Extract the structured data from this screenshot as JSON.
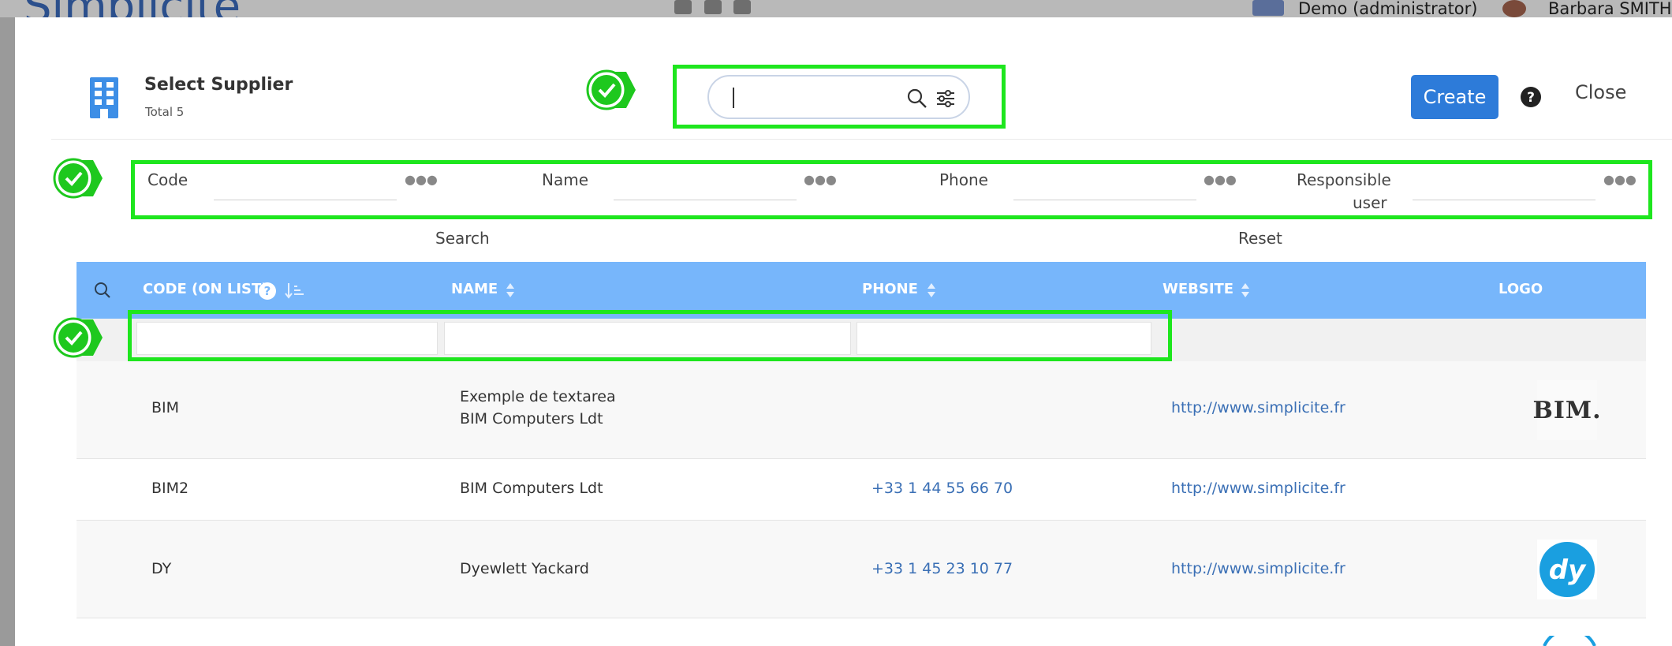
{
  "background": {
    "app_name": "Simplicite",
    "user_scope": "Demo (administrator)",
    "user_name": "Barbara SMITH"
  },
  "header": {
    "title": "Select Supplier",
    "subtitle": "Total 5",
    "search_value": "",
    "create_label": "Create",
    "close_label": "Close"
  },
  "filters": {
    "fields": [
      {
        "label": "Code"
      },
      {
        "label": "Name"
      },
      {
        "label": "Phone"
      },
      {
        "label_line1": "Responsible",
        "label_line2": "user"
      }
    ],
    "search_label": "Search",
    "reset_label": "Reset"
  },
  "table": {
    "columns": [
      "CODE (ON LIST)",
      "NAME",
      "PHONE",
      "WEBSITE",
      "LOGO"
    ],
    "rows": [
      {
        "code": "BIM",
        "name_line1": "Exemple de textarea",
        "name_line2": "BIM Computers Ldt",
        "phone": "",
        "website": "http://www.simplicite.fr",
        "logo_text": "BIM."
      },
      {
        "code": "BIM2",
        "name_line1": "BIM Computers Ldt",
        "name_line2": "",
        "phone": "+33 1 44 55 66 70",
        "website": "http://www.simplicite.fr",
        "logo_text": ""
      },
      {
        "code": "DY",
        "name_line1": "Dyewlett Yackard",
        "name_line2": "",
        "phone": "+33 1 45 23 10 77",
        "website": "http://www.simplicite.fr",
        "logo_text": "dy"
      }
    ]
  },
  "colors": {
    "highlight": "#1ee61e",
    "header_bg": "#77b6fb",
    "create_bg": "#2d7bd9",
    "link": "#3a6fb5"
  }
}
